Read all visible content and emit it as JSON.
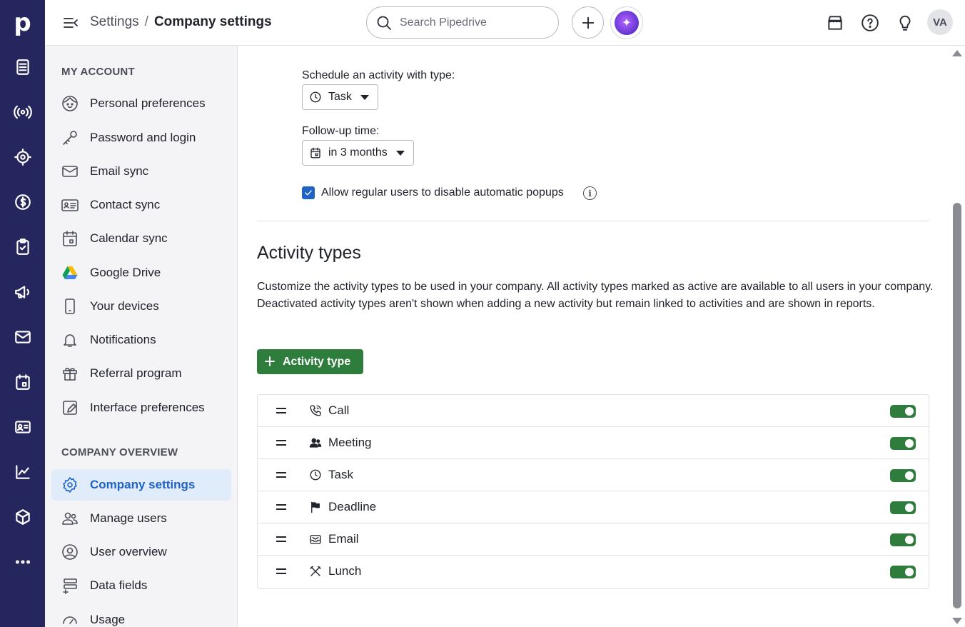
{
  "app": {
    "logo": "p"
  },
  "breadcrumb": {
    "parent": "Settings",
    "separator": "/",
    "current": "Company settings"
  },
  "search": {
    "placeholder": "Search Pipedrive"
  },
  "user": {
    "initials": "VA"
  },
  "sidebar": {
    "my_account_title": "MY ACCOUNT",
    "my_account": [
      {
        "label": "Personal preferences",
        "icon": "smiley-icon"
      },
      {
        "label": "Password and login",
        "icon": "key-icon"
      },
      {
        "label": "Email sync",
        "icon": "envelope-icon"
      },
      {
        "label": "Contact sync",
        "icon": "contact-card-icon"
      },
      {
        "label": "Calendar sync",
        "icon": "calendar-icon"
      },
      {
        "label": "Google Drive",
        "icon": "google-drive-icon"
      },
      {
        "label": "Your devices",
        "icon": "phone-icon"
      },
      {
        "label": "Notifications",
        "icon": "bell-icon"
      },
      {
        "label": "Referral program",
        "icon": "gift-icon"
      },
      {
        "label": "Interface preferences",
        "icon": "pen-square-icon"
      }
    ],
    "company_title": "COMPANY OVERVIEW",
    "company": [
      {
        "label": "Company settings",
        "icon": "gear-icon",
        "active": true
      },
      {
        "label": "Manage users",
        "icon": "users-icon"
      },
      {
        "label": "User overview",
        "icon": "user-circle-icon"
      },
      {
        "label": "Data fields",
        "icon": "data-fields-icon"
      },
      {
        "label": "Usage",
        "icon": "gauge-icon"
      }
    ]
  },
  "form": {
    "schedule_label": "Schedule an activity with type:",
    "schedule_value": "Task",
    "followup_label": "Follow-up time:",
    "followup_value": "in 3 months",
    "allow_label": "Allow regular users to disable automatic popups",
    "allow_checked": true,
    "info_glyph": "i"
  },
  "activity_types": {
    "title": "Activity types",
    "description": "Customize the activity types to be used in your company. All activity types marked as active are available to all users in your company. Deactivated activity types aren't shown when adding a new activity but remain linked to activities and are shown in reports.",
    "add_button": "Activity type",
    "items": [
      {
        "name": "Call",
        "icon": "phone-call-icon",
        "active": true
      },
      {
        "name": "Meeting",
        "icon": "people-icon",
        "active": true
      },
      {
        "name": "Task",
        "icon": "clock-icon",
        "active": true
      },
      {
        "name": "Deadline",
        "icon": "flag-icon",
        "active": true
      },
      {
        "name": "Email",
        "icon": "inbox-icon",
        "active": true
      },
      {
        "name": "Lunch",
        "icon": "utensils-icon",
        "active": true
      }
    ]
  },
  "colors": {
    "rail": "#26265e",
    "accent": "#1f63c6",
    "green": "#2e7d3c"
  }
}
